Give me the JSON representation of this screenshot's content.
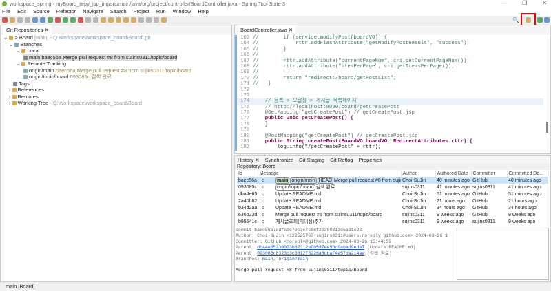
{
  "window": {
    "title": "workspace_spring - myBoard_repy_jsp_ing/src/main/java/org/project/controller/BoardController.java - Spring Tool Suite 3"
  },
  "menu": [
    "File",
    "Edit",
    "Source",
    "Refactor",
    "Navigate",
    "Search",
    "Project",
    "Run",
    "Window",
    "Help"
  ],
  "annotation": "git",
  "git_repos": {
    "tab": "Git Repositories",
    "repo": "Board",
    "repo_branch": "[main]",
    "repo_path": "- Q:\\workspace\\workspace_board\\Board\\.git",
    "branches": "Branches",
    "local": "Local",
    "local_main": "main baec56a Merge pull request #8 from sujins0311/topic/board",
    "remote_tracking": "Remote Tracking",
    "origin_main": "origin/main",
    "origin_main_info": "baec56a Merge pull request #8 from sujins0311/topic/board",
    "origin_topic": "origin/topic/board",
    "origin_topic_info": "093085c 검색 완료",
    "tags": "Tags",
    "references": "References",
    "remotes": "Remotes",
    "working_tree": "Working Tree",
    "working_tree_path": "- Q:\\workspace\\workspace_board\\Board"
  },
  "editor": {
    "tab": "BoardController.java",
    "lines": [
      {
        "n": "163",
        "t": "//        if (service.modifyPost(boardVO)) {"
      },
      {
        "n": "164",
        "t": "//            rttr.addFlashAttribute(\"getModifyPostResult\", \"success\");"
      },
      {
        "n": "165",
        "t": "//        }"
      },
      {
        "n": "166",
        "t": "//"
      },
      {
        "n": "167",
        "t": "//        rttr.addAttribute(\"currentPageNum\", cri.getCurrentPageNum());"
      },
      {
        "n": "168",
        "t": "//        rttr.addAttribute(\"itemPerPage\", cri.getItemsPerPage());"
      },
      {
        "n": "169",
        "t": "//"
      },
      {
        "n": "170",
        "t": "//        return \"redirect:/board/getPostList\";"
      },
      {
        "n": "171",
        "t": "//   }"
      },
      {
        "n": "172",
        "t": ""
      },
      {
        "n": "173",
        "t": ""
      },
      {
        "n": "174",
        "t": "    // 등록 > 모달창 > 게시글 목록페이지"
      },
      {
        "n": "175",
        "t": "    // http://localhost:8080/board/getCreatePost"
      },
      {
        "n": "176",
        "t": "    @GetMapping(\"getCreatePost\") // getCreatePost.jsp"
      },
      {
        "n": "177",
        "t": "    public void getCreatePost() {"
      },
      {
        "n": "178",
        "t": "    }"
      },
      {
        "n": "179",
        "t": ""
      },
      {
        "n": "180",
        "t": "    @PostMapping(\"getCreatePost\") // getCreatePost.jsp"
      },
      {
        "n": "181",
        "t": "    public String createPost(BoardVO boardVO, RedirectAttributes rttr) {"
      },
      {
        "n": "182",
        "t": "        log.info(\"/getCreatePost\" + rttr);"
      }
    ]
  },
  "history": {
    "tabs": [
      "History",
      "Synchronize",
      "Git Staging",
      "Git Reflog",
      "Properties"
    ],
    "repository": "Repository: Board",
    "columns": [
      "Id",
      "Message",
      "Author",
      "Authored Date",
      "Committer",
      "Committed Da..."
    ],
    "rows": [
      {
        "id": "baec56a",
        "refs": [
          "main",
          "origin/main",
          "HEAD"
        ],
        "msg": "Merge pull request #8 from sujins0311/topic/board",
        "author": "Choi-SuJin",
        "adate": "40 minutes ago",
        "committer": "GitHub",
        "cdate": "40 minutes ago"
      },
      {
        "id": "093085c",
        "refs": [
          "origin/topic/board"
        ],
        "msg": "검색 완료",
        "author": "sujins0311",
        "adate": "41 minutes ago",
        "committer": "sujins0311",
        "cdate": "41 minutes ago"
      },
      {
        "id": "dba4e65",
        "refs": [],
        "msg": "Update README.md",
        "author": "Choi-SuJin",
        "adate": "51 minutes ago",
        "committer": "GitHub",
        "cdate": "51 minutes ago"
      },
      {
        "id": "2a40b82",
        "refs": [],
        "msg": "Update README.md",
        "author": "Choi-SuJin",
        "adate": "21 hours ago",
        "committer": "GitHub",
        "cdate": "21 hours ago"
      },
      {
        "id": "b34d2aa",
        "refs": [],
        "msg": "Update README.md",
        "author": "Choi-SuJin",
        "adate": "34 hours ago",
        "committer": "GitHub",
        "cdate": "34 hours ago"
      },
      {
        "id": "636b23d",
        "refs": [],
        "msg": "Merge pull request #6 from sujins0311/topic/board",
        "author": "sujins0311",
        "adate": "9 weeks ago",
        "committer": "GitHub",
        "cdate": "9 weeks ago"
      },
      {
        "id": "b95541c",
        "refs": [],
        "msg": "게시글조회(페이징)추가",
        "author": "sujins0311",
        "adate": "9 weeks ago",
        "committer": "sujins0311",
        "cdate": "9 weeks ago"
      }
    ],
    "details": {
      "commit": "commit baec56a7adfa0c70c3e7c68f20300313c5a31e22",
      "author": "Author: Choi-SuJin <122525760+sujins0311@users.noreply.github.com> 2024-03-26 15:44:59",
      "committer": "Committer: GitHub <noreply@github.com> 2024-03-26 15:44:59",
      "parent_label": "Parent: ",
      "parent1": "dba4e65230023b82312efb597ee58c9abad9ede7",
      "parent1_note": " (Update README.md)",
      "parent2": "093085c8323c3c3812f6226a8dbaf4a57da214aa",
      "parent2_note": " (검색 완료)",
      "branches_label": "Branches: ",
      "branch1": "main",
      "branch2": "origin/main",
      "message": "Merge pull request #8 from sujins0311/topic/board"
    }
  },
  "status": "main [Board]"
}
